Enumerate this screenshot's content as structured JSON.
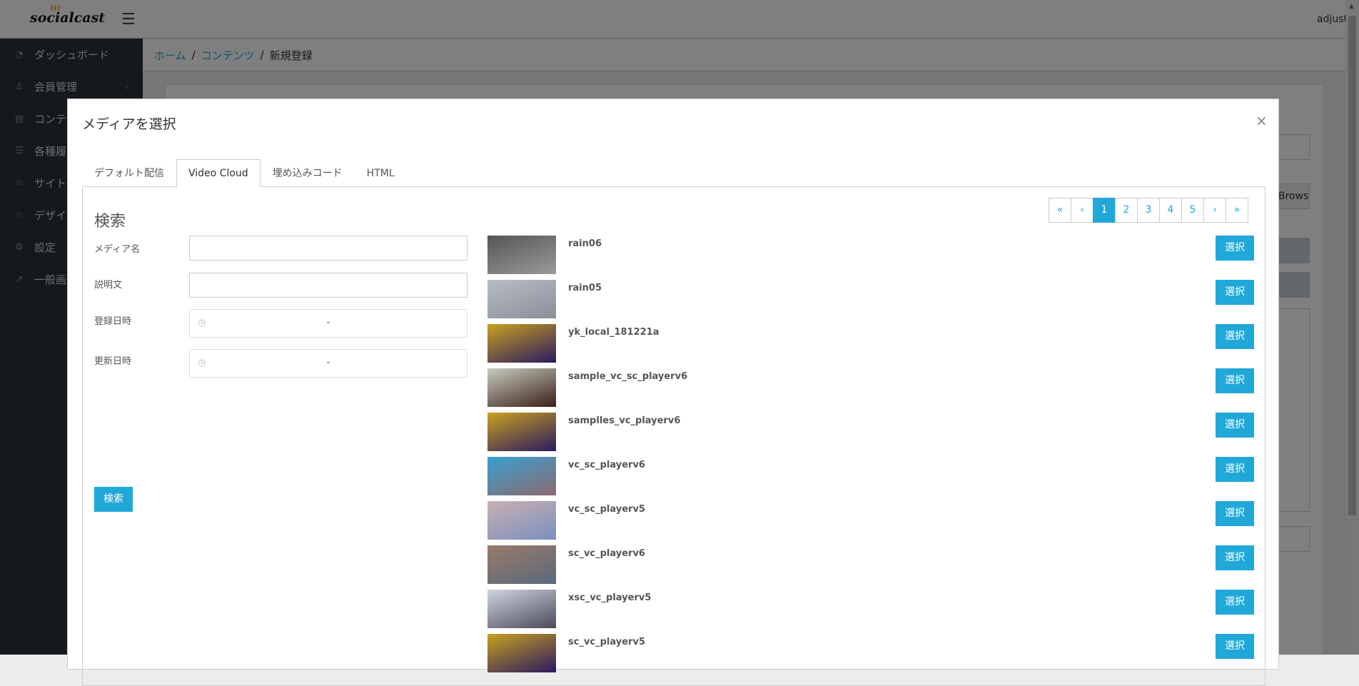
{
  "header": {
    "logo": "socialcast",
    "user": "adjust"
  },
  "sidebar": {
    "items": [
      {
        "label": "ダッシュボード",
        "icon": "dashboard-icon"
      },
      {
        "label": "会員管理",
        "icon": "user-icon"
      },
      {
        "label": "コンテ",
        "icon": "content-icon"
      },
      {
        "label": "各種履",
        "icon": "list-icon"
      },
      {
        "label": "サイト",
        "icon": "star-icon"
      },
      {
        "label": "デザイ",
        "icon": "star-icon"
      },
      {
        "label": "設定",
        "icon": "gear-icon"
      },
      {
        "label": "一般画",
        "icon": "external-link-icon"
      }
    ]
  },
  "breadcrumb": {
    "home": "ホーム",
    "contents": "コンテンツ",
    "current": "新規登録",
    "sep": "/"
  },
  "background": {
    "browse": "Browse"
  },
  "modal": {
    "title": "メディアを選択",
    "close": "×",
    "tabs": [
      "デフォルト配信",
      "Video Cloud",
      "埋め込みコード",
      "HTML"
    ],
    "active_tab": "Video Cloud",
    "search": {
      "heading": "検索",
      "media_name_label": "メディア名",
      "media_name_value": "",
      "description_label": "説明文",
      "description_value": "",
      "created_label": "登録日時",
      "created_value": "-",
      "updated_label": "更新日時",
      "updated_value": "-",
      "submit": "検索"
    },
    "pagination": {
      "first": "«",
      "prev": "‹",
      "pages": [
        "1",
        "2",
        "3",
        "4",
        "5"
      ],
      "current": "1",
      "next": "›",
      "last": "»"
    },
    "select_label": "選択",
    "items": [
      {
        "name": "rain06",
        "c1": "#555",
        "c2": "#9a9a9a"
      },
      {
        "name": "rain05",
        "c1": "#b8bcc4",
        "c2": "#8a9098"
      },
      {
        "name": "yk_local_181221a",
        "c1": "#c8a020",
        "c2": "#2a1a60"
      },
      {
        "name": "sample_vc_sc_playerv6",
        "c1": "#c8ccc0",
        "c2": "#3a2018"
      },
      {
        "name": "samplles_vc_playerv6",
        "c1": "#c8a020",
        "c2": "#2a1a60"
      },
      {
        "name": "vc_sc_playerv6",
        "c1": "#3aa0d0",
        "c2": "#8a6a70"
      },
      {
        "name": "vc_sc_playerv5",
        "c1": "#c8b0b0",
        "c2": "#7a90c0"
      },
      {
        "name": "sc_vc_playerv6",
        "c1": "#9a7a6a",
        "c2": "#5a6a7a"
      },
      {
        "name": "xsc_vc_playerv5",
        "c1": "#d0d4e0",
        "c2": "#4a4a5a"
      },
      {
        "name": "sc_vc_playerv5",
        "c1": "#c8a020",
        "c2": "#2a1a60"
      }
    ]
  }
}
